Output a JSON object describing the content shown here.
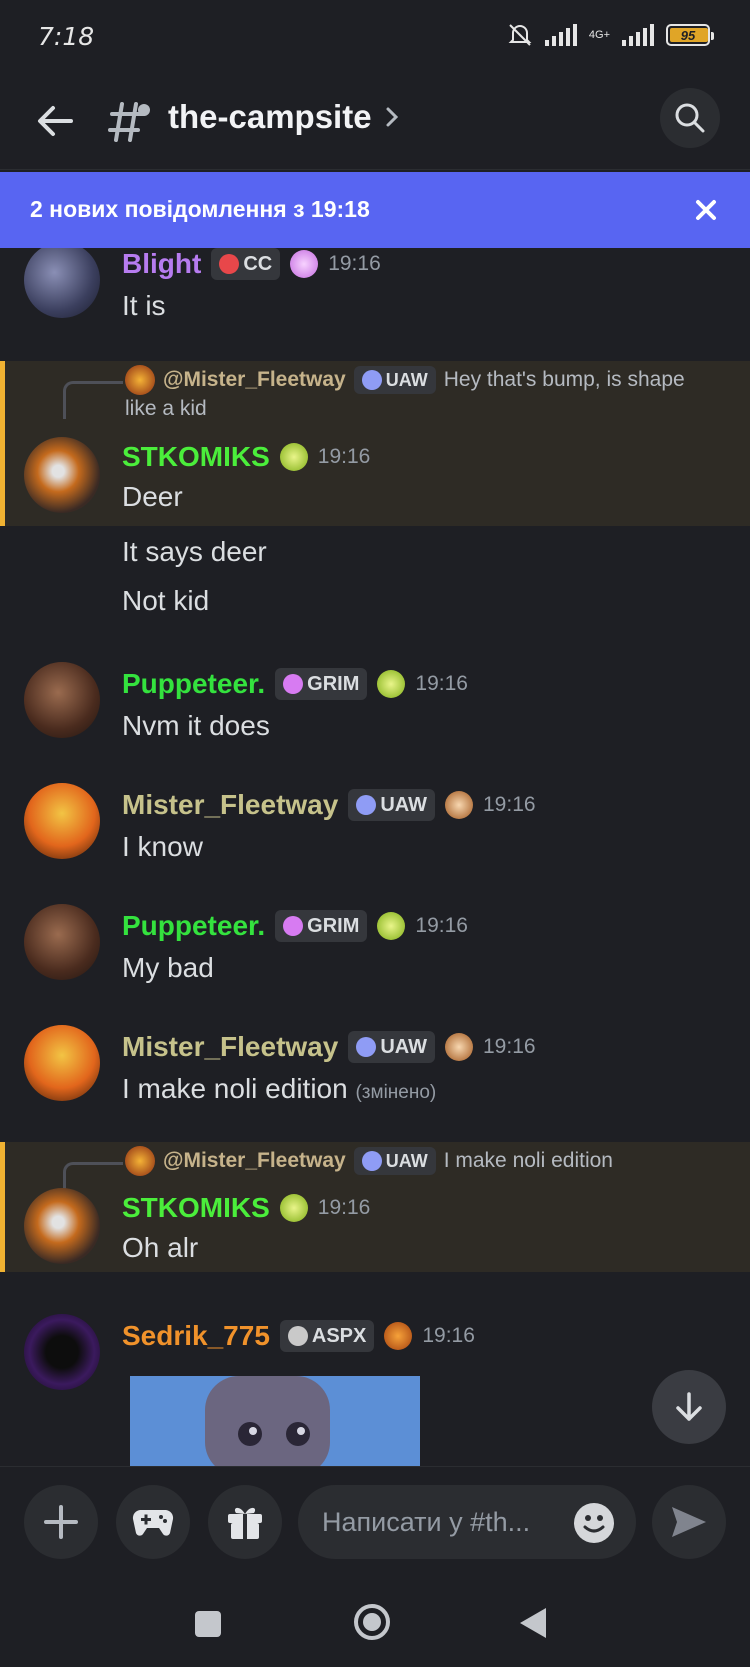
{
  "status": {
    "time": "7:18",
    "network": "4G+",
    "battery": "95"
  },
  "header": {
    "channel": "the-campsite"
  },
  "banner": {
    "text": "2 нових повідомлення з 19:18"
  },
  "messages": {
    "m1": {
      "author": "Blight",
      "badge": "CC",
      "time": "19:16",
      "text": "It is"
    },
    "m2": {
      "reply_to": "@Mister_Fleetway",
      "reply_badge": "UAW",
      "reply_text": "Hey that's bump, is shape",
      "reply_text_cont": "like a kid",
      "author": "STKOMIKS",
      "time": "19:16",
      "lines": [
        "Deer",
        "It says deer",
        "Not kid"
      ]
    },
    "m3": {
      "author": "Puppeteer.",
      "badge": "GRIM",
      "time": "19:16",
      "text": "Nvm it does"
    },
    "m4": {
      "author": "Mister_Fleetway",
      "badge": "UAW",
      "time": "19:16",
      "text": "I know"
    },
    "m5": {
      "author": "Puppeteer.",
      "badge": "GRIM",
      "time": "19:16",
      "text": "My bad"
    },
    "m6": {
      "author": "Mister_Fleetway",
      "badge": "UAW",
      "time": "19:16",
      "text": "I make noli edition",
      "edited": "(змінено)"
    },
    "m7": {
      "reply_to": "@Mister_Fleetway",
      "reply_badge": "UAW",
      "reply_text": "I make noli edition",
      "author": "STKOMIKS",
      "time": "19:16",
      "text": "Oh alr"
    },
    "m8": {
      "author": "Sedrik_775",
      "badge": "ASPX",
      "time": "19:16"
    }
  },
  "composer": {
    "placeholder": "Написати у #th..."
  },
  "colors": {
    "blight": "#b77cf0",
    "stkomiks": "#4bee3b",
    "puppeteer": "#34e23e",
    "fleetway": "#c6c28b",
    "sedrik": "#f0922b",
    "accent": "#5865f2"
  }
}
